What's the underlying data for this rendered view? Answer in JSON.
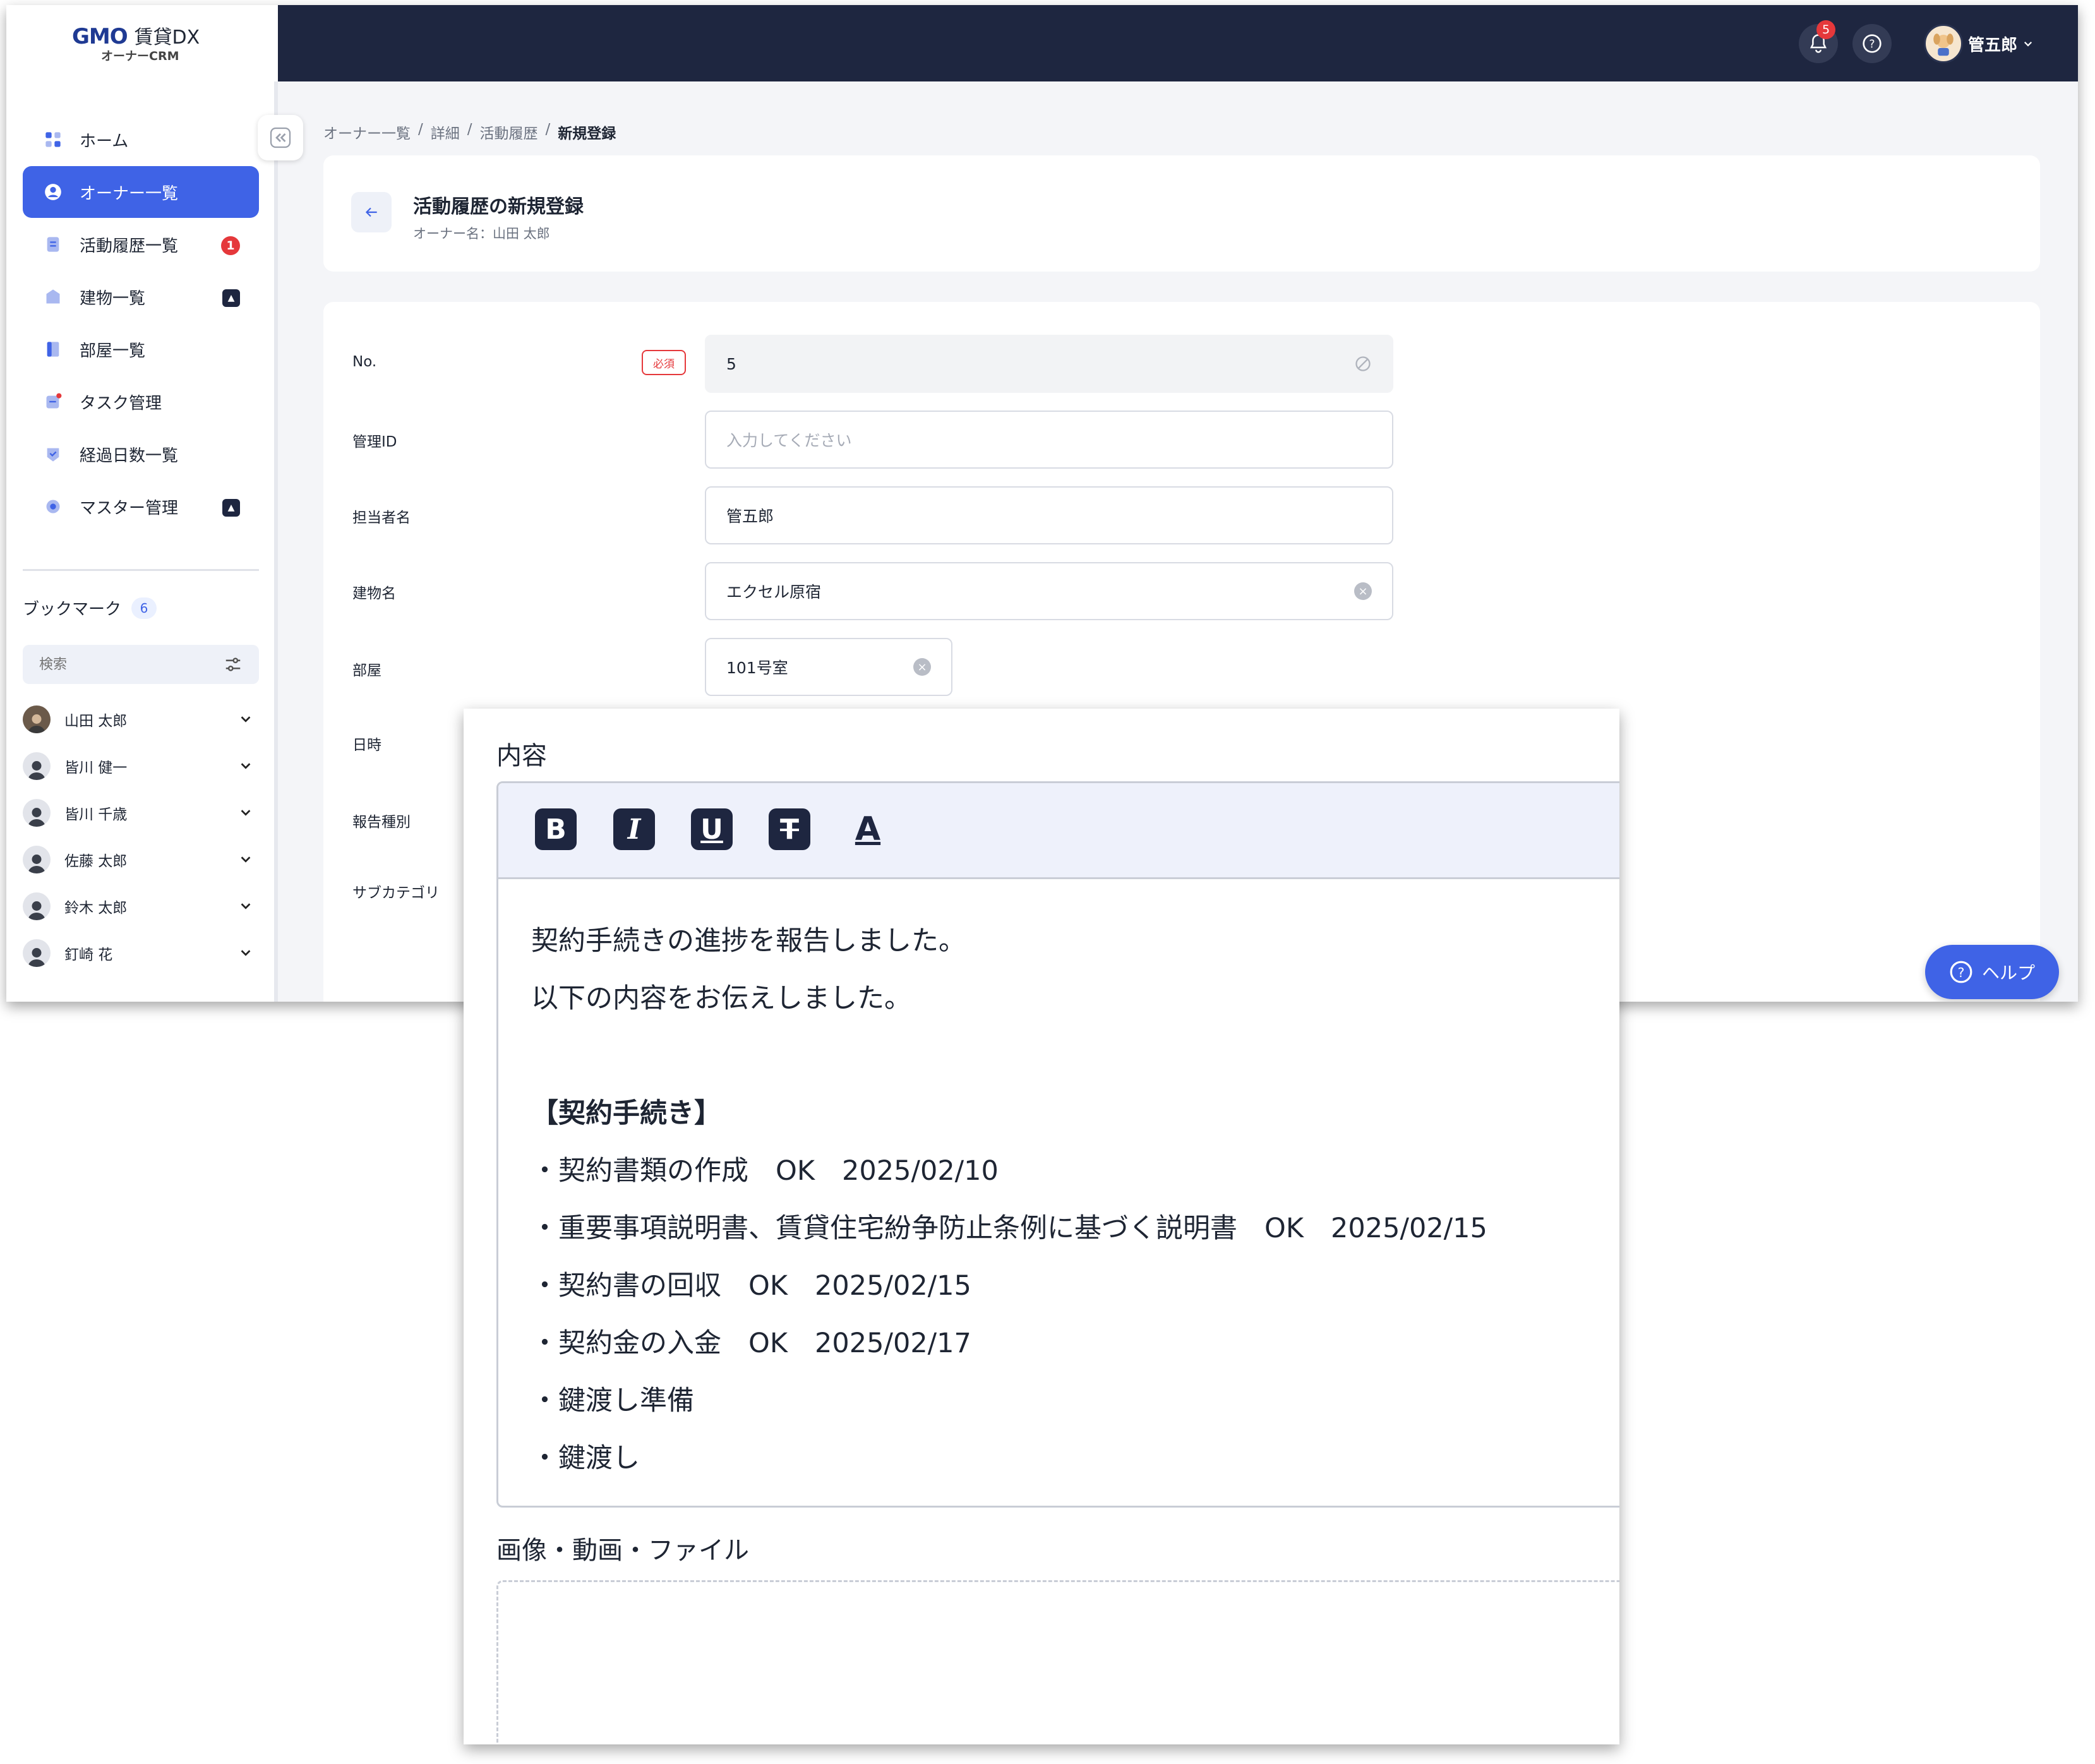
{
  "app": {
    "logo_main": "GMO",
    "logo_dx": "賃貸DX",
    "logo_sub": "オーナーCRM",
    "notification_count": "5",
    "user_name": "管五郎"
  },
  "sidebar": {
    "items": [
      {
        "label": "ホーム"
      },
      {
        "label": "オーナー一覧"
      },
      {
        "label": "活動履歴一覧",
        "badge": "1"
      },
      {
        "label": "建物一覧"
      },
      {
        "label": "部屋一覧"
      },
      {
        "label": "タスク管理"
      },
      {
        "label": "経過日数一覧"
      },
      {
        "label": "マスター管理"
      }
    ],
    "bookmark_title": "ブックマーク",
    "bookmark_count": "6",
    "search_placeholder": "検索",
    "bookmarks": [
      "山田 太郎",
      "皆川 健一",
      "皆川 千歳",
      "佐藤 太郎",
      "鈴木 太郎",
      "釘崎 花"
    ]
  },
  "breadcrumb": [
    "オーナー一覧",
    "詳細",
    "活動履歴",
    "新規登録"
  ],
  "breadcrumb_sep": "/",
  "header": {
    "title": "活動履歴の新規登録",
    "subtitle": "オーナー名：山田 太郎"
  },
  "form": {
    "required_label": "必須",
    "fields": {
      "no": {
        "label": "No.",
        "value": "5"
      },
      "manage_id": {
        "label": "管理ID",
        "placeholder": "入力してください"
      },
      "staff": {
        "label": "担当者名",
        "value": "管五郎"
      },
      "building": {
        "label": "建物名",
        "value": "エクセル原宿"
      },
      "room": {
        "label": "部屋",
        "value": "101号室"
      },
      "datetime": {
        "label": "日時"
      },
      "report_type": {
        "label": "報告種別"
      },
      "subcategory": {
        "label": "サブカテゴリ"
      }
    }
  },
  "help_button": "ヘルプ",
  "zoom": {
    "content_label": "内容",
    "toolbar": [
      "B",
      "I",
      "U",
      "T",
      "A"
    ],
    "lines": [
      "契約手続きの進捗を報告しました。",
      "以下の内容をお伝えしました。",
      "",
      "【契約手続き】",
      "・契約書類の作成　OK　2025/02/10",
      "・重要事項説明書、賃貸住宅紛争防止条例に基づく説明書　OK　2025/02/15",
      "・契約書の回収　OK　2025/02/15",
      "・契約金の入金　OK　2025/02/17",
      "・鍵渡し準備",
      "・鍵渡し"
    ],
    "attachment_label": "画像・動画・ファイル"
  },
  "colors": {
    "primary": "#3f63e6",
    "topbar": "#1e2640",
    "danger": "#e5383b"
  }
}
